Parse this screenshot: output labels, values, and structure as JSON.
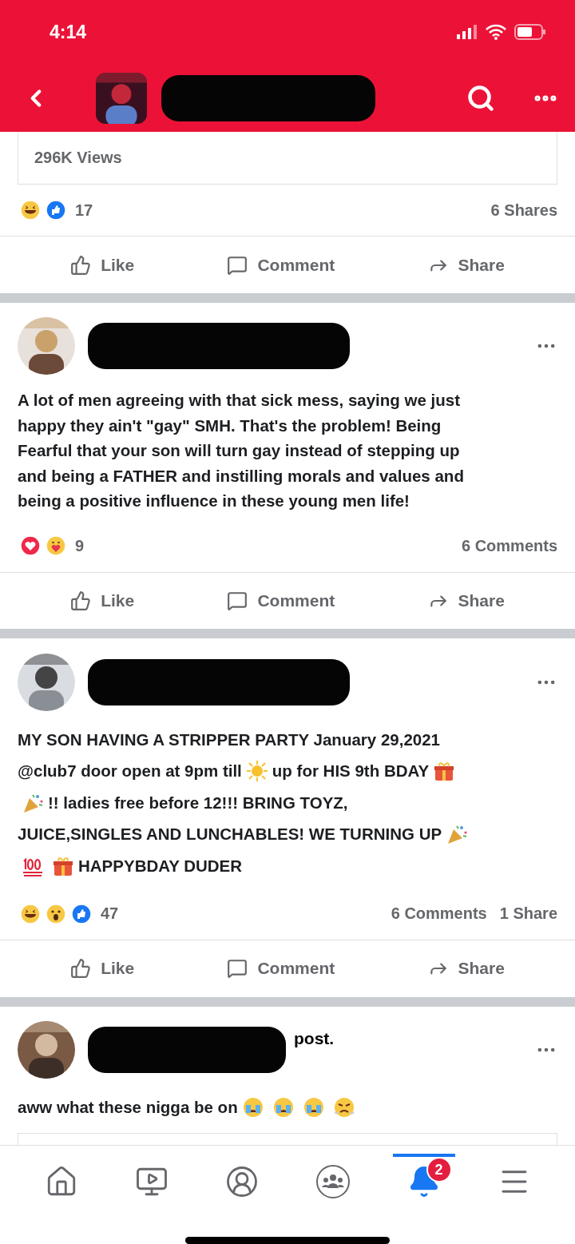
{
  "status_bar": {
    "time": "4:14"
  },
  "top_bar": {
    "avatar": {
      "kind": "picture"
    }
  },
  "posts": [
    {
      "views": "296K Views",
      "reactions": [
        {
          "kind": "haha"
        },
        {
          "kind": "like"
        }
      ],
      "reaction_count": "17",
      "stats": [
        "6 Shares"
      ],
      "actions": [
        "Like",
        "Comment",
        "Share"
      ]
    },
    {
      "author": {
        "avatar": {
          "kind": "picture"
        }
      },
      "lines": [
        [
          {
            "kind": "text",
            "text": "A lot of men agreeing with that sick mess, saying we just"
          }
        ],
        [
          {
            "kind": "text",
            "text": "happy they ain't \"gay\" SMH. That's the problem! Being"
          }
        ],
        [
          {
            "kind": "text",
            "text": "Fearful that your son will turn gay instead of stepping up"
          }
        ],
        [
          {
            "kind": "text",
            "text": "and being a FATHER and instilling morals and values and"
          }
        ],
        [
          {
            "kind": "text",
            "text": "being a positive influence in these young men life!"
          }
        ]
      ],
      "reactions": [
        {
          "kind": "love"
        },
        {
          "kind": "care"
        }
      ],
      "reaction_count": "9",
      "stats": [
        "6 Comments"
      ],
      "actions": [
        "Like",
        "Comment",
        "Share"
      ]
    },
    {
      "author": {
        "avatar": {
          "kind": "picture"
        }
      },
      "lines": [
        [
          {
            "kind": "text",
            "text": "MY SON HAVING A STRIPPER PARTY January 29,2021"
          }
        ],
        [
          {
            "kind": "text",
            "text": "@club7 door open at 9pm till"
          },
          {
            "kind": "sun"
          },
          {
            "kind": "text",
            "text": "up for HIS 9th BDAY"
          },
          {
            "kind": "gift"
          }
        ],
        [
          {
            "kind": "party"
          },
          {
            "kind": "text",
            "text": "!! ladies free before 12!!! BRING TOYZ,"
          }
        ],
        [
          {
            "kind": "text",
            "text": "JUICE,SINGLES AND LUNCHABLES! WE TURNING UP"
          },
          {
            "kind": "party"
          }
        ],
        [
          {
            "kind": "hundred"
          },
          {
            "kind": "gift"
          },
          {
            "kind": "text",
            "text": "HAPPYBDAY DUDER"
          }
        ]
      ],
      "reactions": [
        {
          "kind": "haha"
        },
        {
          "kind": "wow"
        },
        {
          "kind": "like"
        }
      ],
      "reaction_count": "47",
      "stats": [
        "6 Comments",
        "1 Share"
      ],
      "actions": [
        "Like",
        "Comment",
        "Share"
      ]
    },
    {
      "author": {
        "avatar": {
          "kind": "picture"
        },
        "suffix": "post."
      },
      "lines": [
        [
          {
            "kind": "text",
            "text": "aww what these nigga be on"
          },
          {
            "kind": "crying"
          },
          {
            "kind": "crying"
          },
          {
            "kind": "crying"
          },
          {
            "kind": "angry"
          }
        ]
      ]
    }
  ],
  "nav": [
    {
      "kind": "home",
      "selected": false
    },
    {
      "kind": "video",
      "selected": false
    },
    {
      "kind": "profile",
      "selected": false
    },
    {
      "kind": "groups",
      "selected": false
    },
    {
      "kind": "notifications",
      "selected": true,
      "badge": "2"
    },
    {
      "kind": "menu",
      "selected": false
    }
  ]
}
